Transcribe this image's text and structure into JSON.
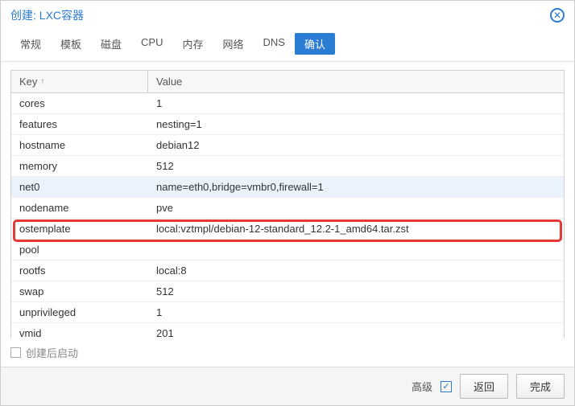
{
  "header": {
    "title": "创建: LXC容器"
  },
  "tabs": [
    {
      "label": "常规",
      "active": false
    },
    {
      "label": "模板",
      "active": false
    },
    {
      "label": "磁盘",
      "active": false
    },
    {
      "label": "CPU",
      "active": false
    },
    {
      "label": "内存",
      "active": false
    },
    {
      "label": "网络",
      "active": false
    },
    {
      "label": "DNS",
      "active": false
    },
    {
      "label": "确认",
      "active": true
    }
  ],
  "table": {
    "header_key": "Key",
    "header_value": "Value",
    "rows": [
      {
        "key": "cores",
        "value": "1"
      },
      {
        "key": "features",
        "value": "nesting=1"
      },
      {
        "key": "hostname",
        "value": "debian12"
      },
      {
        "key": "memory",
        "value": "512"
      },
      {
        "key": "net0",
        "value": "name=eth0,bridge=vmbr0,firewall=1",
        "highlight": true
      },
      {
        "key": "nodename",
        "value": "pve"
      },
      {
        "key": "ostemplate",
        "value": "local:vztmpl/debian-12-standard_12.2-1_amd64.tar.zst",
        "callout": true
      },
      {
        "key": "pool",
        "value": ""
      },
      {
        "key": "rootfs",
        "value": "local:8"
      },
      {
        "key": "swap",
        "value": "512"
      },
      {
        "key": "unprivileged",
        "value": "1"
      },
      {
        "key": "vmid",
        "value": "201"
      }
    ]
  },
  "bottom": {
    "start_after_create": "创建后启动"
  },
  "footer": {
    "advanced": "高级",
    "back": "返回",
    "finish": "完成"
  }
}
